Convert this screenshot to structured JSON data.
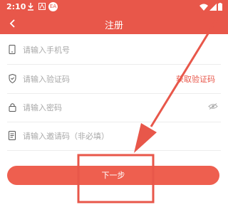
{
  "status_bar": {
    "time": "2:10",
    "badge": "EA"
  },
  "header": {
    "title": "注册"
  },
  "form": {
    "phone_placeholder": "请输入手机号",
    "code_placeholder": "请输入验证码",
    "get_code_label": "获取验证码",
    "password_placeholder": "请输入密码",
    "invite_placeholder": "请输入邀请码（非必填）"
  },
  "next_button": {
    "label": "下一步"
  },
  "colors": {
    "accent": "#e8574a",
    "button": "#ee5f4f",
    "annotation": "#e8574a"
  },
  "icons": [
    "download-icon",
    "notification-icon",
    "wifi-icon",
    "signal-icon",
    "battery-icon",
    "back-arrow-icon",
    "phone-icon",
    "shield-icon",
    "lock-icon",
    "invite-doc-icon",
    "eye-hidden-icon"
  ]
}
